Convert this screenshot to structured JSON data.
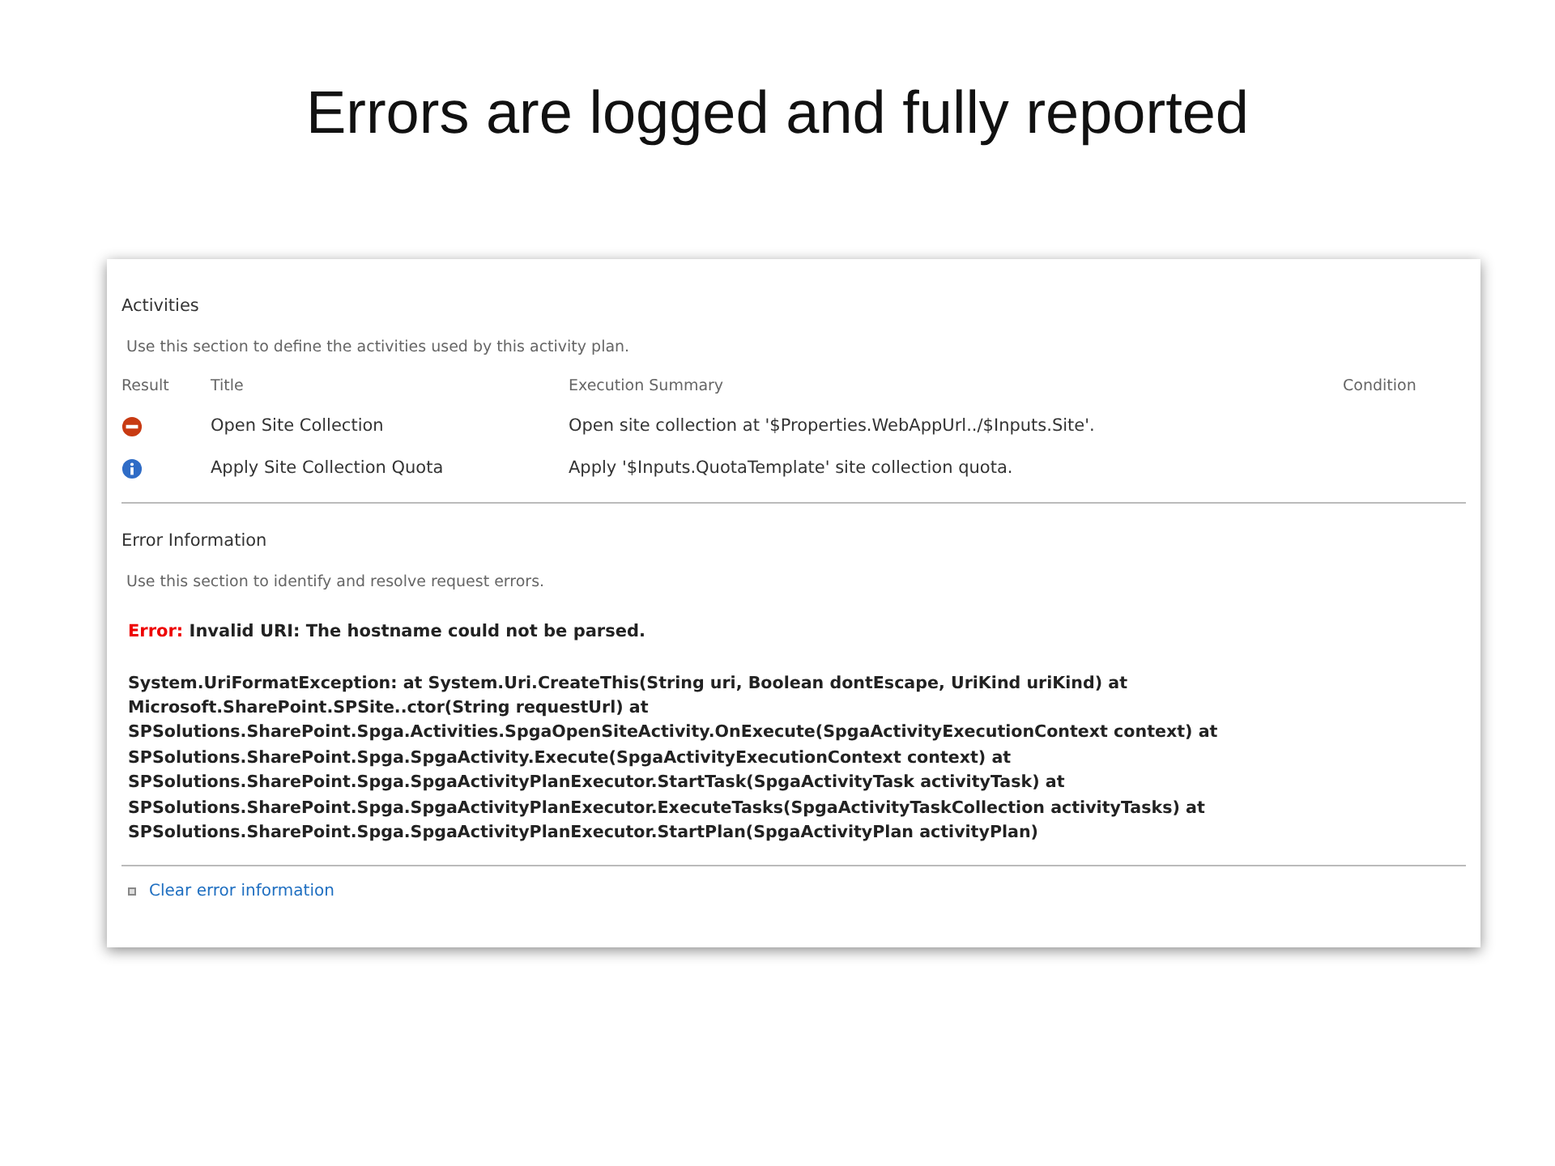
{
  "slide_title": "Errors are logged and fully reported",
  "activities": {
    "heading": "Activities",
    "description": "Use this section to define the activities used by this activity plan.",
    "columns": [
      "Result",
      "Title",
      "Execution Summary",
      "Condition"
    ],
    "rows": [
      {
        "kind": "error",
        "title": "Open Site Collection",
        "summary": "Open site collection at '$Properties.WebAppUrl../$Inputs.Site'."
      },
      {
        "kind": "info",
        "title": "Apply Site Collection Quota",
        "summary": "Apply '$Inputs.QuotaTemplate' site collection quota."
      }
    ]
  },
  "error_information": {
    "heading": "Error Information",
    "description": "Use this section to identify and resolve request errors.",
    "error_label": "Error:",
    "error_message": "Invalid URI: The hostname could not be parsed.",
    "stack_trace": [
      "System.UriFormatException: at System.Uri.CreateThis(String uri, Boolean dontEscape, UriKind uriKind) at",
      "Microsoft.SharePoint.SPSite..ctor(String requestUrl) at",
      "SPSolutions.SharePoint.Spga.Activities.SpgaOpenSiteActivity.OnExecute(SpgaActivityExecutionContext context) at",
      "SPSolutions.SharePoint.Spga.SpgaActivity.Execute(SpgaActivityExecutionContext context) at",
      "SPSolutions.SharePoint.Spga.SpgaActivityPlanExecutor.StartTask(SpgaActivityTask activityTask) at",
      "SPSolutions.SharePoint.Spga.SpgaActivityPlanExecutor.ExecuteTasks(SpgaActivityTaskCollection activityTasks) at",
      "SPSolutions.SharePoint.Spga.SpgaActivityPlanExecutor.StartPlan(SpgaActivityPlan activityPlan)"
    ],
    "clear_link": "Clear error information"
  }
}
